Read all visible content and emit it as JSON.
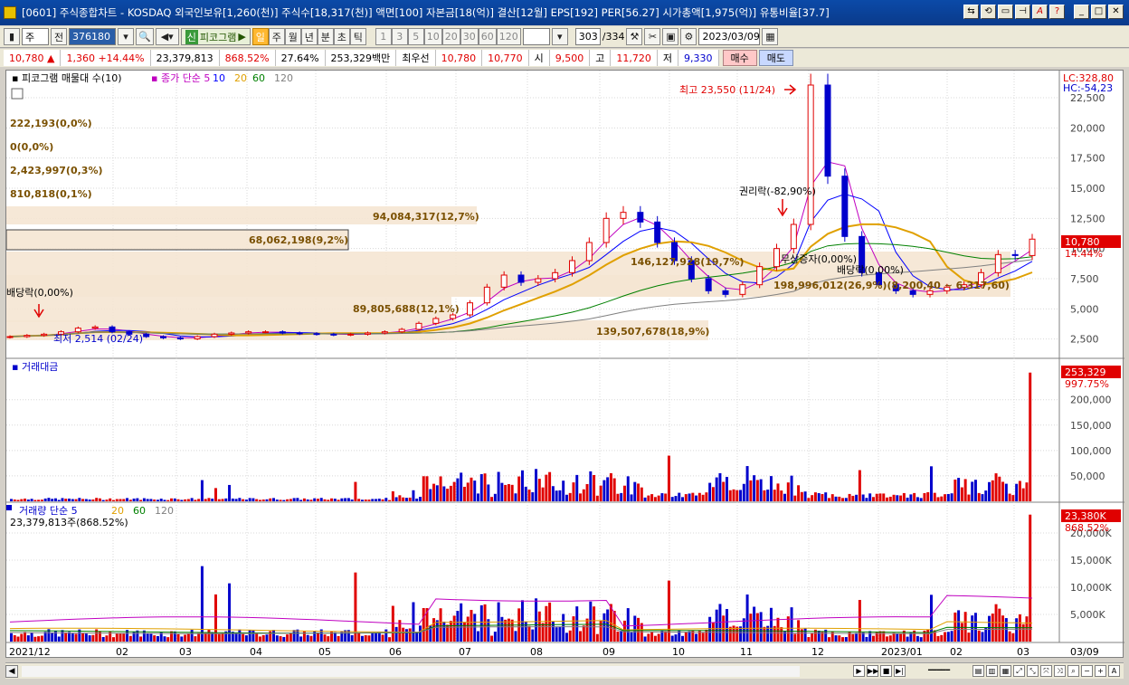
{
  "window": {
    "title": "[0601] 주식종합차트 - KOSDAQ 외국인보유[1,260(천)] 주식수[18,317(천)] 액면[100] 자본금[18(억)] 결산[12월] EPS[192] PER[56.27] 시가총액[1,975(억)] 유통비율[37.7]"
  },
  "toolbar": {
    "type_select": "주",
    "prev_label": "전",
    "code": "376180",
    "fibo_label": "피코그램",
    "period_buttons": [
      "일",
      "주",
      "월",
      "년",
      "분",
      "초",
      "틱"
    ],
    "number_buttons": [
      "1",
      "3",
      "5",
      "10",
      "20",
      "30",
      "60",
      "120"
    ],
    "count": "303",
    "count_total": "/334",
    "date": "2023/03/09"
  },
  "quote": {
    "price": "10,780",
    "change": "1,360",
    "change_pct": "+14.44%",
    "volume": "23,379,813",
    "volume_ratio": "868.52%",
    "turnover": "27.64%",
    "amount": "253,329백만",
    "priority_label": "최우선",
    "ask": "10,780",
    "bid": "10,770",
    "open_label": "시",
    "open": "9,500",
    "high_label": "고",
    "high": "11,720",
    "low_label": "저",
    "low": "9,330",
    "buy_label": "매수",
    "sell_label": "매도"
  },
  "panels": {
    "price": {
      "header_fib": "피코그램 매물대 수(10)",
      "header_ma": "종가 단순",
      "ma_periods": [
        "5",
        "10",
        "20",
        "60",
        "120"
      ],
      "ma_colors": [
        "#c000c0",
        "#0000ff",
        "#e0a000",
        "#008000",
        "#808080"
      ],
      "lc": "LC:328,80",
      "hc": "HC:-54,23",
      "left_labels": [
        "222,193(0,0%)",
        "0(0,0%)",
        "2,423,997(0,3%)",
        "810,818(0,1%)"
      ],
      "volume_profile": [
        {
          "text": "94,084,317(12,7%)"
        },
        {
          "text": "68,062,198(9,2%)"
        },
        {
          "text": "146,127,928(19,7%)"
        },
        {
          "text": "198,996,012(26,9%)(8,200,40 ~ 6,317,60)"
        },
        {
          "text": "89,805,688(12,1%)"
        },
        {
          "text": "139,507,678(18,9%)"
        }
      ],
      "annotations": {
        "high": "최고 23,550 (11/24)",
        "low": "최저 2,514 (02/24)",
        "rights": "권리락(-82,90%)",
        "bonus": "무상증자(0,00%)",
        "dividend1": "배당락(0,00%)",
        "dividend2": "배당락(0,00%)"
      },
      "y_ticks": [
        "22,500",
        "20,000",
        "17,500",
        "15,000",
        "12,500",
        "10,000",
        "7,500",
        "5,000",
        "2,500"
      ],
      "last_price": "10,780",
      "last_pct": "14.44%"
    },
    "amount": {
      "header": "거래대금",
      "y_ticks": [
        "200,000",
        "150,000",
        "100,000",
        "50,000"
      ],
      "last_value": "253,329",
      "last_pct": "997.75%"
    },
    "volume": {
      "header": "거래량",
      "header_ma": "단순",
      "ma_periods": [
        "5",
        "20",
        "60",
        "120"
      ],
      "sub": "23,379,813주(868.52%)",
      "y_ticks": [
        "20,000K",
        "15,000K",
        "10,000K",
        "5,000K"
      ],
      "last_value": "23,380K",
      "last_pct": "868.52%"
    }
  },
  "x_axis": [
    "2021/12",
    "02",
    "03",
    "04",
    "05",
    "06",
    "07",
    "08",
    "09",
    "10",
    "11",
    "12",
    "2023/01",
    "02",
    "03",
    "03/09"
  ],
  "chart_data": {
    "type": "candlestick",
    "series_close": [
      2700,
      2800,
      2900,
      3100,
      3400,
      3500,
      3100,
      2900,
      2700,
      2600,
      2514,
      2700,
      2900,
      3000,
      3100,
      3100,
      3000,
      2950,
      2900,
      2850,
      2900,
      3000,
      3100,
      3300,
      3800,
      4200,
      4500,
      5500,
      6800,
      7800,
      7200,
      7500,
      8000,
      9000,
      10500,
      12500,
      13000,
      12200,
      10500,
      9000,
      7500,
      6500,
      6200,
      7000,
      8500,
      10000,
      12000,
      23550,
      16000,
      11000,
      8000,
      7000,
      6500,
      6200,
      6500,
      6800,
      7000,
      8000,
      9500,
      9420,
      10780
    ],
    "ylim": [
      1500,
      24000
    ]
  },
  "colors": {
    "up": "#e00000",
    "down": "#0000cc",
    "profile": "#f5e6d3"
  }
}
